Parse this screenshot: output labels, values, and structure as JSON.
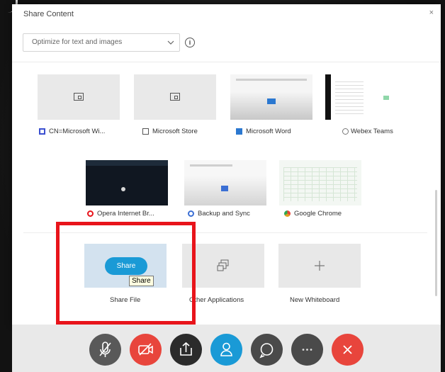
{
  "dialog": {
    "title": "Share Content",
    "close": "×",
    "optimize": {
      "value": "Optimize for text and images",
      "info": "i"
    }
  },
  "windows": [
    {
      "label": "CN=Microsoft Wi...",
      "icon": "app-window-icon",
      "icon_color": "#3b4fd0"
    },
    {
      "label": "Microsoft Store",
      "icon": "store-window-icon",
      "icon_color": "#555555"
    },
    {
      "label": "Microsoft Word",
      "icon": "word-icon",
      "icon_color": "#2b78d0"
    },
    {
      "label": "Webex Teams",
      "icon": "webex-icon",
      "icon_color": "#777777"
    },
    {
      "label": "Opera Internet Br...",
      "icon": "opera-icon",
      "icon_color": "#e8141b"
    },
    {
      "label": "Backup and Sync",
      "icon": "backup-sync-icon",
      "icon_color": "#3b6fd4"
    },
    {
      "label": "Google Chrome",
      "icon": "chrome-icon",
      "icon_color": "#e0a020"
    }
  ],
  "actions": {
    "share_file": {
      "button": "Share",
      "label": "Share File",
      "tooltip": "Share"
    },
    "other_apps": {
      "label": "Other Applications",
      "icon": "stacked-windows-icon"
    },
    "whiteboard": {
      "label": "New Whiteboard",
      "icon": "plus-icon"
    }
  },
  "toolbar": [
    {
      "name": "mute-button",
      "icon": "microphone-muted-icon",
      "color": "#595959"
    },
    {
      "name": "stop-video-button",
      "icon": "camera-off-icon",
      "color": "#e8453c"
    },
    {
      "name": "share-button",
      "icon": "share-screen-icon",
      "color": "#2b2b2b"
    },
    {
      "name": "participants-button",
      "icon": "participants-icon",
      "color": "#1a9ad6"
    },
    {
      "name": "chat-button",
      "icon": "chat-icon",
      "color": "#4a4a4a"
    },
    {
      "name": "more-options-button",
      "icon": "more-icon",
      "color": "#4a4a4a"
    },
    {
      "name": "leave-meeting-button",
      "icon": "close-icon",
      "color": "#e8453c"
    }
  ],
  "colors": {
    "accent": "#1a9ad6",
    "annotation": "#e8141b"
  }
}
